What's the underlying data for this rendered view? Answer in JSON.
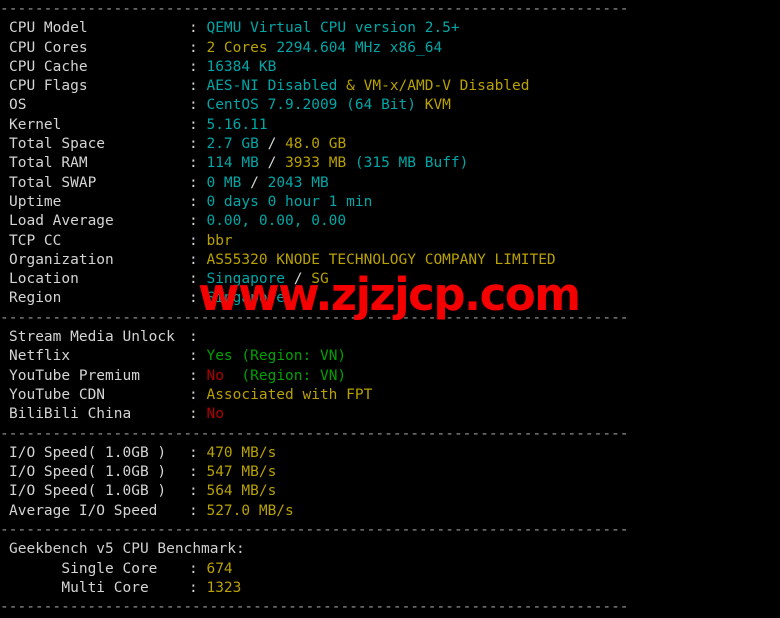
{
  "terminal": {
    "separator": "------------------------------------------------------------------------",
    "watermark": "www.zjzjcp.com",
    "colors": {
      "background": "#000000",
      "label": "#d4d4d4",
      "cyan": "#00a6a6",
      "yellow": "#b8a100",
      "green": "#00a000",
      "red": "#b00000",
      "separator": "#9a9a9a",
      "watermark": "#f40000"
    },
    "sections": {
      "system_info": {
        "rows": [
          {
            "label": "CPU Model",
            "value_1": "QEMU Virtual CPU version 2.5+"
          },
          {
            "label": "CPU Cores",
            "value_1": "2 Cores",
            "value_2": "2294.604 MHz x86_64"
          },
          {
            "label": "CPU Cache",
            "value_1": "16384 KB"
          },
          {
            "label": "CPU Flags",
            "value_1": "AES-NI Disabled",
            "value_2": "&",
            "value_3": "VM-x/AMD-V Disabled"
          },
          {
            "label": "OS",
            "value_1": "CentOS 7.9.2009 (64 Bit)",
            "value_2": "KVM"
          },
          {
            "label": "Kernel",
            "value_1": "5.16.11"
          },
          {
            "label": "Total Space",
            "value_1": "2.7 GB",
            "value_2": "/",
            "value_3": "48.0 GB"
          },
          {
            "label": "Total RAM",
            "value_1": "114 MB",
            "value_2": "/",
            "value_3": "3933 MB",
            "value_4": "(315 MB Buff)"
          },
          {
            "label": "Total SWAP",
            "value_1": "0 MB",
            "value_2": "/",
            "value_3": "2043 MB"
          },
          {
            "label": "Uptime",
            "value_1": "0 days 0 hour 1 min"
          },
          {
            "label": "Load Average",
            "value_1": "0.00, 0.00, 0.00"
          },
          {
            "label": "TCP CC",
            "value_1": "bbr"
          },
          {
            "label": "Organization",
            "value_1": "AS55320 KNODE TECHNOLOGY COMPANY LIMITED"
          },
          {
            "label": "Location",
            "value_1": "Singapore",
            "value_2": "/",
            "value_3": "SG"
          },
          {
            "label": "Region",
            "value_1": "Singapore"
          }
        ]
      },
      "stream_media": {
        "heading_label": "Stream Media Unlock",
        "heading_value": "",
        "rows": [
          {
            "label": "Netflix",
            "value_1": "Yes",
            "value_2": "(Region: VN)"
          },
          {
            "label": "YouTube Premium",
            "value_1": "No",
            "value_2": "(Region: VN)"
          },
          {
            "label": "YouTube CDN",
            "value_1": "Associated with FPT"
          },
          {
            "label": "BiliBili China",
            "value_1": "No"
          }
        ]
      },
      "io_speed": {
        "rows": [
          {
            "label": "I/O Speed( 1.0GB )",
            "value_1": "470 MB/s"
          },
          {
            "label": "I/O Speed( 1.0GB )",
            "value_1": "547 MB/s"
          },
          {
            "label": "I/O Speed( 1.0GB )",
            "value_1": "564 MB/s"
          },
          {
            "label": "Average I/O Speed",
            "value_1": "527.0 MB/s"
          }
        ]
      },
      "geekbench": {
        "heading": "Geekbench v5 CPU Benchmark:",
        "rows": [
          {
            "label": "      Single Core",
            "value_1": "674"
          },
          {
            "label": "      Multi Core",
            "value_1": "1323"
          }
        ]
      }
    }
  }
}
